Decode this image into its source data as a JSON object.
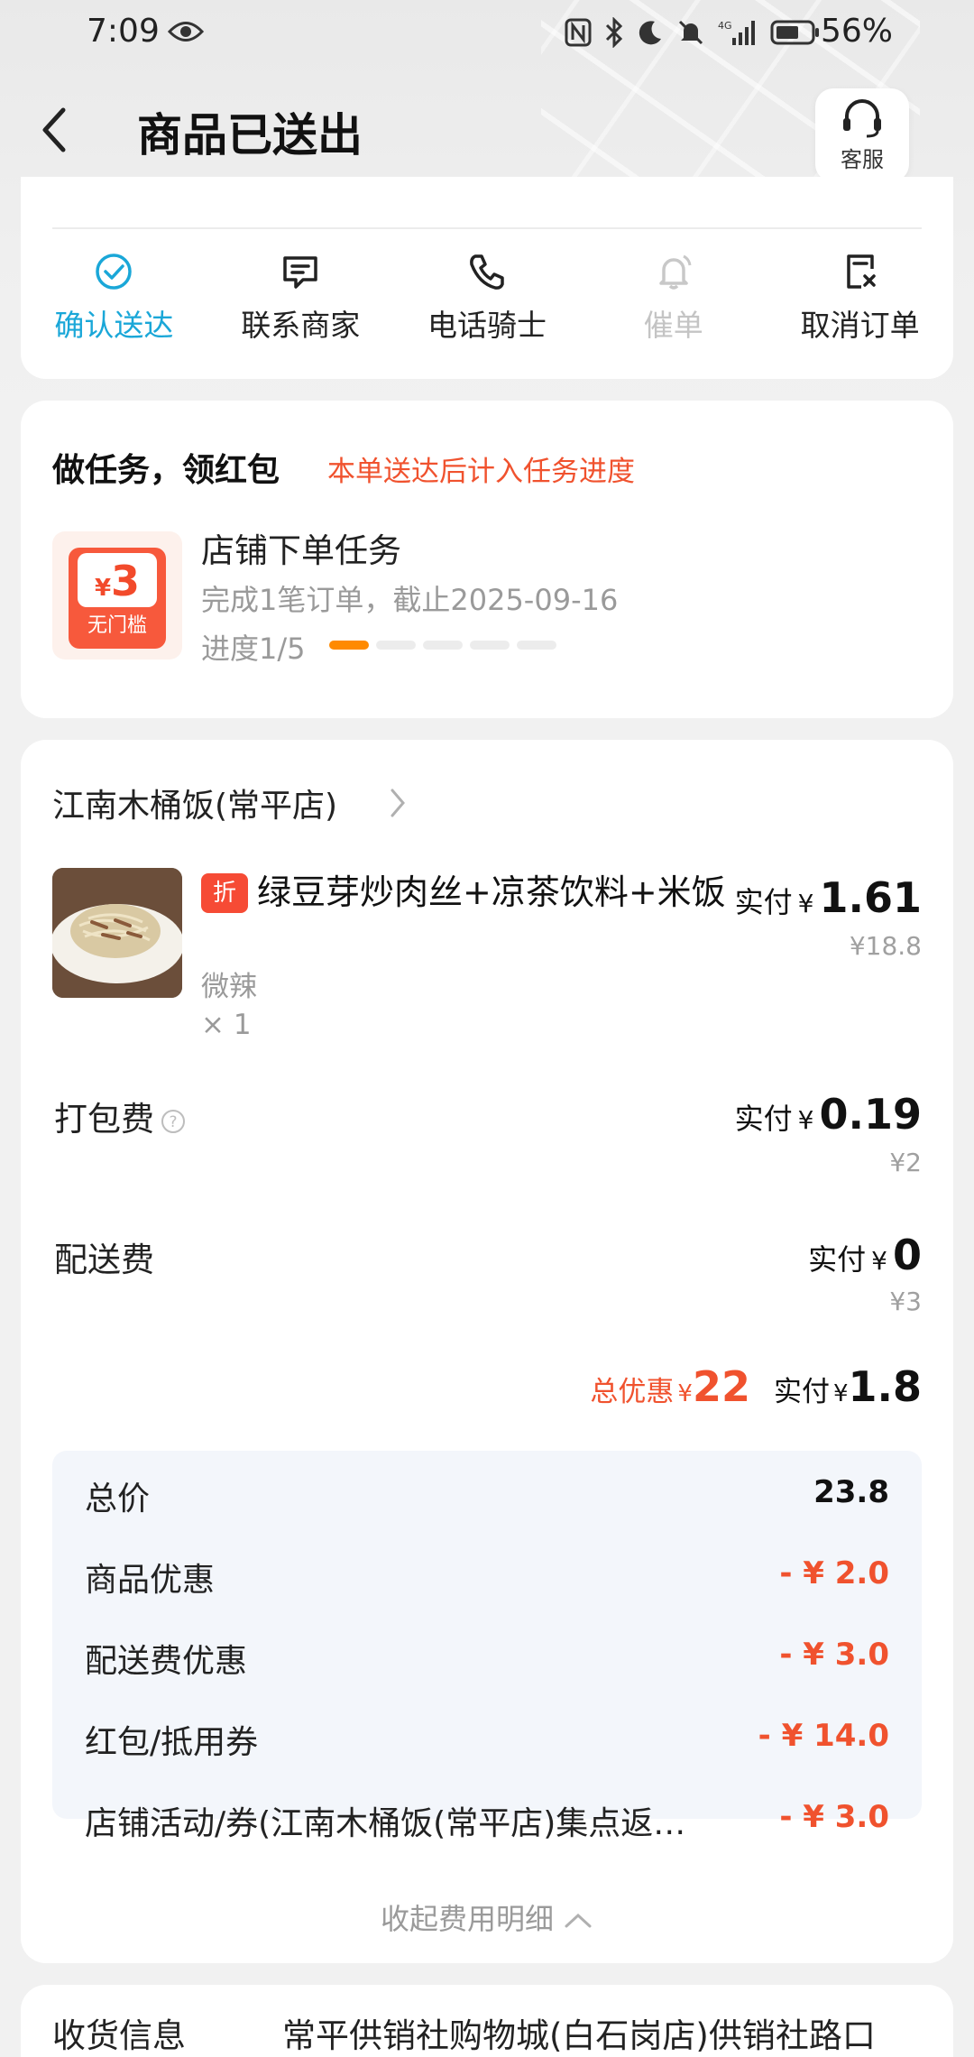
{
  "status_bar": {
    "time": "7:09",
    "battery_percent": "56%",
    "network": "4G"
  },
  "nav": {
    "title": "商品已送出",
    "service_label": "客服"
  },
  "actions": [
    {
      "label": "确认送达",
      "icon": "check-circle-icon",
      "state": "active"
    },
    {
      "label": "联系商家",
      "icon": "chat-icon",
      "state": "normal"
    },
    {
      "label": "电话骑士",
      "icon": "phone-icon",
      "state": "normal"
    },
    {
      "label": "催单",
      "icon": "bell-icon",
      "state": "disabled"
    },
    {
      "label": "取消订单",
      "icon": "cancel-doc-icon",
      "state": "normal"
    }
  ],
  "task": {
    "title": "做任务，领红包",
    "note": "本单送达后计入任务进度",
    "coupon_symbol": "¥",
    "coupon_amount": "3",
    "coupon_condition": "无门槛",
    "name": "店铺下单任务",
    "desc": "完成1笔订单，截止2025-09-16",
    "progress_text": "进度1/5",
    "progress_done": 1,
    "progress_total": 5
  },
  "order": {
    "shop_name": "江南木桶饭(常平店)",
    "item": {
      "tag": "折",
      "name": "绿豆芽炒肉丝+凉茶饮料+米饭",
      "spec": "微辣",
      "qty": "× 1",
      "paid_label": "实付",
      "currency": "¥",
      "paid": "1.61",
      "original": "¥18.8"
    },
    "packing": {
      "label": "打包费",
      "paid_label": "实付",
      "currency": "¥",
      "paid": "0.19",
      "original": "¥2"
    },
    "delivery": {
      "label": "配送费",
      "paid_label": "实付",
      "currency": "¥",
      "paid": "0",
      "original": "¥3"
    },
    "summary": {
      "discount_label": "总优惠",
      "currency": "¥",
      "discount": "22",
      "paid_label": "实付",
      "paid": "1.8"
    },
    "breakdown": [
      {
        "label": "总价",
        "value": "23.8",
        "red": false
      },
      {
        "label": "商品优惠",
        "value": "- ¥ 2.0",
        "red": true
      },
      {
        "label": "配送费优惠",
        "value": "- ¥ 3.0",
        "red": true
      },
      {
        "label": "红包/抵用券",
        "value": "- ¥ 14.0",
        "red": true
      },
      {
        "label": "店铺活动/券(江南木桶饭(常平店)集点返…",
        "value": "- ¥ 3.0",
        "red": true
      }
    ],
    "collapse_label": "收起费用明细"
  },
  "address": {
    "label": "收货信息",
    "value": "常平供销社购物城(白石岗店)供销社路口"
  },
  "colors": {
    "accent_blue": "#1aa7d8",
    "discount_red": "#f0522e",
    "progress_orange": "#ff8a00"
  }
}
